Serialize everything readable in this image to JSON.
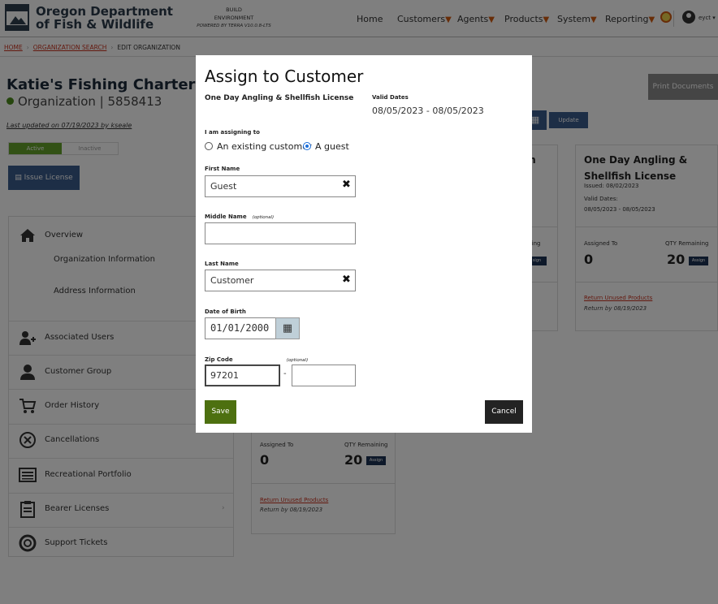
{
  "header": {
    "brand_line1": "Oregon Department",
    "brand_line2": "of Fish & Wildlife",
    "build_line1": "BUILD",
    "build_line2": "ENVIRONMENT",
    "build_line3": "POWERED BY TERRA V10.0.8-LTS",
    "nav": [
      {
        "label": "Home",
        "caret": ""
      },
      {
        "label": "Customers",
        "caret": "▼"
      },
      {
        "label": "Agents",
        "caret": "▼"
      },
      {
        "label": "Products",
        "caret": "▼"
      },
      {
        "label": "System",
        "caret": "▼"
      },
      {
        "label": "Reporting",
        "caret": "▼"
      }
    ],
    "user_label": "eyct ▾"
  },
  "breadcrumb": {
    "home": "HOME",
    "search": "ORGANIZATION SEARCH",
    "current": "EDIT ORGANIZATION",
    "sep": "›"
  },
  "org": {
    "name": "Katie's Fishing Charter",
    "subtitle": "Organization | 5858413",
    "updated": "Last updated on 07/19/2023 by kseale",
    "active": "Active",
    "inactive": "Inactive",
    "issue_label": "Issue License"
  },
  "sidebar": {
    "items": [
      {
        "label": "Overview",
        "icon": "home-icon"
      },
      {
        "label": "Organization Information",
        "icon": ""
      },
      {
        "label": "Address Information",
        "icon": ""
      },
      {
        "label": "Associated Users",
        "icon": "user-plus-icon"
      },
      {
        "label": "Customer Group",
        "icon": "user-icon"
      },
      {
        "label": "Order History",
        "icon": "cart-icon"
      },
      {
        "label": "Cancellations",
        "icon": "x-circle-icon"
      },
      {
        "label": "Recreational Portfolio",
        "icon": "list-icon"
      },
      {
        "label": "Bearer Licenses",
        "icon": "clipboard-icon"
      },
      {
        "label": "Support Tickets",
        "icon": "lifebuoy-icon"
      }
    ],
    "bearer_caret": "›"
  },
  "right": {
    "print_label": "Print Documents",
    "update_label": "Update",
    "card_right": {
      "title": "One Day Angling & Shellfish License",
      "issued": "Issued: 08/02/2023",
      "valid_label": "Valid Dates:",
      "valid": "08/05/2023 - 08/05/2023",
      "assigned_to": "Assigned To",
      "qty_label": "QTY Remaining",
      "assigned_value": "0",
      "qty_value": "20",
      "assign": "Assign",
      "return": "Return Unused Products",
      "return_by": "Return by 08/19/2023"
    },
    "card_mid": {
      "title_frag": "sh",
      "qty_frag": "aining",
      "assign_frag": "sign"
    },
    "card_bottom": {
      "assigned_to": "Assigned To",
      "qty_label": "QTY Remaining",
      "assigned_value": "0",
      "qty_value": "20",
      "assign": "Assign",
      "return": "Return Unused Products",
      "return_by": "Return by 08/19/2023"
    }
  },
  "modal": {
    "title": "Assign to Customer",
    "product": "One Day Angling & Shellfish License",
    "valid_label": "Valid Dates",
    "valid": "08/05/2023 - 08/05/2023",
    "assigning_label": "I am assigning to",
    "opt_existing": "An existing customer",
    "opt_guest": "A guest",
    "first_label": "First Name",
    "first_value": "Guest",
    "middle_label": "Middle Name",
    "middle_opt": "(optional)",
    "middle_value": "",
    "last_label": "Last Name",
    "last_value": "Customer",
    "dob_label": "Date of Birth",
    "dob_value": "01/01/2000",
    "zip_label": "Zip Code",
    "zip_opt": "(optional)",
    "zip_value": "97201",
    "zip_ext_value": "",
    "dash": "-",
    "save": "Save",
    "cancel": "Cancel"
  }
}
